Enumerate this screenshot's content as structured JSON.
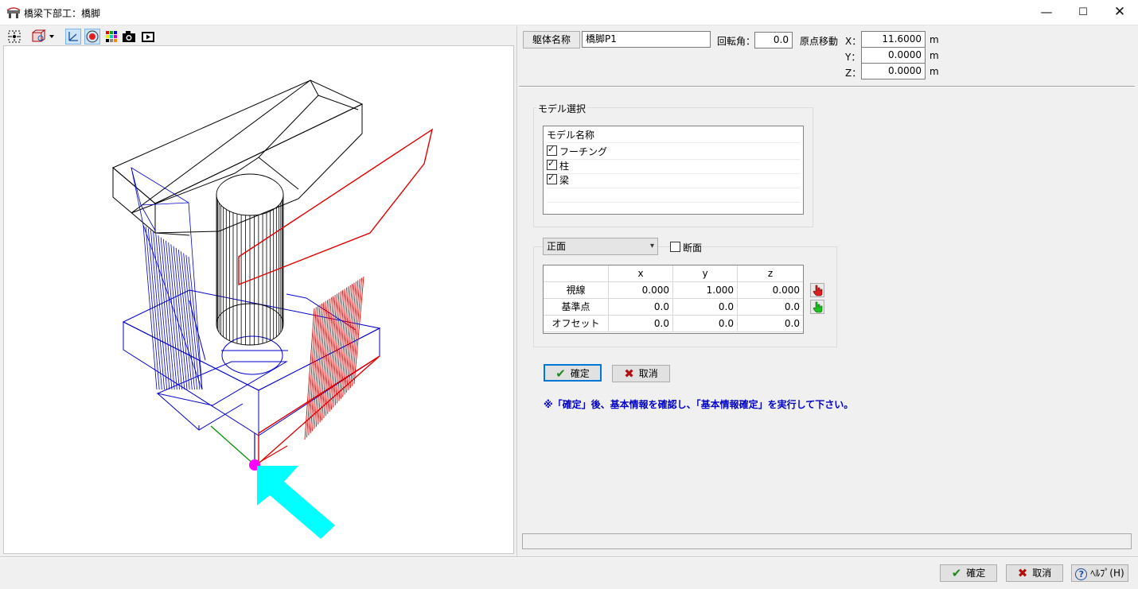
{
  "window": {
    "title": "橋梁下部工：橋脚",
    "app_icon": "bridge-app-icon",
    "controls": {
      "minimize": "—",
      "maximize": "☐",
      "close": "✕"
    }
  },
  "toolbar": {
    "items": [
      {
        "name": "zoom-fit-icon",
        "label": ""
      },
      {
        "name": "view-orientation-icon",
        "label": ""
      },
      {
        "name": "axis-toggle-icon",
        "label": ""
      },
      {
        "name": "target-icon",
        "label": ""
      },
      {
        "name": "color-palette-icon",
        "label": ""
      },
      {
        "name": "camera-icon",
        "label": ""
      },
      {
        "name": "record-video-icon",
        "label": ""
      }
    ]
  },
  "header": {
    "body_name_button": "躯体名称",
    "body_name_value": "橋脚P1",
    "rotation_label": "回転角：",
    "rotation_value": "0.0",
    "origin_label": "原点移動",
    "x_label": "X：",
    "x_value": "11.6000",
    "y_label": "Y：",
    "y_value": "0.0000",
    "z_label": "Z：",
    "z_value": "0.0000",
    "unit": "m"
  },
  "model_select": {
    "group_title": "モデル選択",
    "list_header": "モデル名称",
    "items": [
      {
        "label": "フーチング",
        "checked": true
      },
      {
        "label": "柱",
        "checked": true
      },
      {
        "label": "梁",
        "checked": true
      }
    ]
  },
  "view_settings": {
    "view_select_value": "正面",
    "section_checkbox_label": "断面",
    "section_checked": false,
    "grid": {
      "headers": [
        "",
        "x",
        "y",
        "z"
      ],
      "rows": [
        {
          "label": "視線",
          "x": "0.000",
          "y": "1.000",
          "z": "0.000"
        },
        {
          "label": "基準点",
          "x": "0.0",
          "y": "0.0",
          "z": "0.0"
        },
        {
          "label": "オフセット",
          "x": "0.0",
          "y": "0.0",
          "z": "0.0"
        }
      ]
    },
    "pick_icons": [
      "red-hand-pointer-icon",
      "green-hand-pointer-icon"
    ]
  },
  "actions": {
    "confirm_label": "確定",
    "cancel_label": "取消"
  },
  "note": "※「確定」後、基本情報を確認し、「基本情報確定」を実行して下さい。",
  "footer": {
    "confirm_label": "確定",
    "cancel_label": "取消",
    "help_label": "ﾍﾙﾌﾟ(H)"
  },
  "colors": {
    "model_line": "#000000",
    "selected_face": "#ff0000",
    "column_face": "#0000c8",
    "view_arrow": "#00ffff",
    "origin_marker": "#ff00ff",
    "note_text": "#0000c8"
  }
}
